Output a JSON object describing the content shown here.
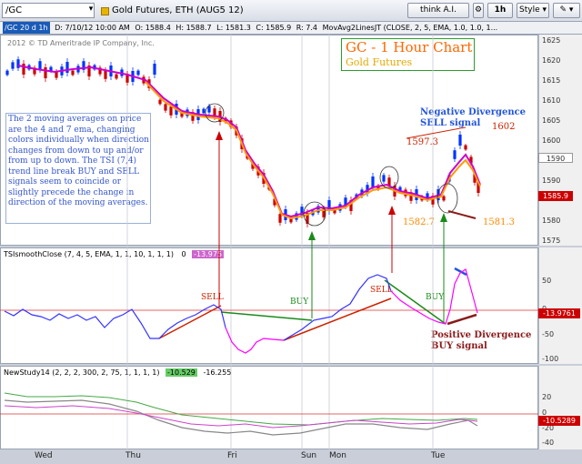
{
  "toolbar": {
    "symbol": "/GC",
    "title": "Gold Futures, ETH (AUG5 12)",
    "think_label": "think A.I.",
    "timeframe": "1h",
    "style_label": "Style",
    "icons": [
      "search-icon",
      "chevron-down-icon",
      "chevron-down-icon",
      "gear-icon",
      "drawing-icon",
      "bell-icon",
      "lock-icon",
      "help-icon"
    ]
  },
  "infobar": {
    "period": "/GC 20 d 1h",
    "date": "D: 7/10/12 10:00 AM",
    "open": "O: 1588.4",
    "high": "H: 1588.7",
    "low": "L: 1581.3",
    "close": "C: 1585.9",
    "range": "R: 7.4",
    "study": "MovAvg2LinesJT (CLOSE, 2, 5, EMA, 1.0, 1.0, 1..."
  },
  "copyright": "2012 © TD Ameritrade IP Company, Inc.",
  "price_pane": {
    "title": "GC - 1 Hour Chart",
    "subtitle": "Gold Futures",
    "ticks": [
      "1625",
      "1620",
      "1615",
      "1610",
      "1605",
      "1600",
      "1595",
      "1590",
      "1585",
      "1580",
      "1575"
    ],
    "price_tags": [
      "1590",
      "1585.9"
    ],
    "note": "The 2 moving averages on price are the 4 and 7 ema, changing colors individually when direction changes from down to up and/or from up to down. The TSI (7,4) trend line break BUY and SELL signals seem to coincide or slightly precede the change in direction of the moving averages.",
    "annotations": {
      "neg_div": "Negative Divergence\nSELL signal",
      "p1602": "1602",
      "p1597": "1597.3",
      "p1582": "1582.7",
      "p1581": "1581.3"
    }
  },
  "tsi_pane": {
    "header": "TSIsmoothClose (7, 4, 5, EMA, 1, 1, 10, 1, 1, 1)",
    "v0": "0",
    "v1": "-13.975",
    "ticks": [
      "50",
      "0",
      "-50",
      "-100"
    ],
    "tag": "-13.9761",
    "sell1": "SELL",
    "buy1": "BUY",
    "sell2": "SELL",
    "buy2": "BUY",
    "pos_div": "Positive Divergence\nBUY signal"
  },
  "study_pane": {
    "header": "NewStudy14 (2, 2, 2, 300, 2, 75, 1, 1, 1, 1)",
    "v1": "-10.529",
    "v2": "-16.255",
    "ticks": [
      "20",
      "0",
      "-20",
      "-40"
    ],
    "tag": "-10.5289"
  },
  "xaxis": [
    "Wed",
    "Thu",
    "Fri",
    "Sun",
    "Mon",
    "Tue"
  ],
  "colors": {
    "up": "#0033ff",
    "down": "#cc0000",
    "ema_up": "#cc00cc",
    "ema_down": "#ff9900",
    "note_text": "#3355cc",
    "title": "#ff6600"
  }
}
